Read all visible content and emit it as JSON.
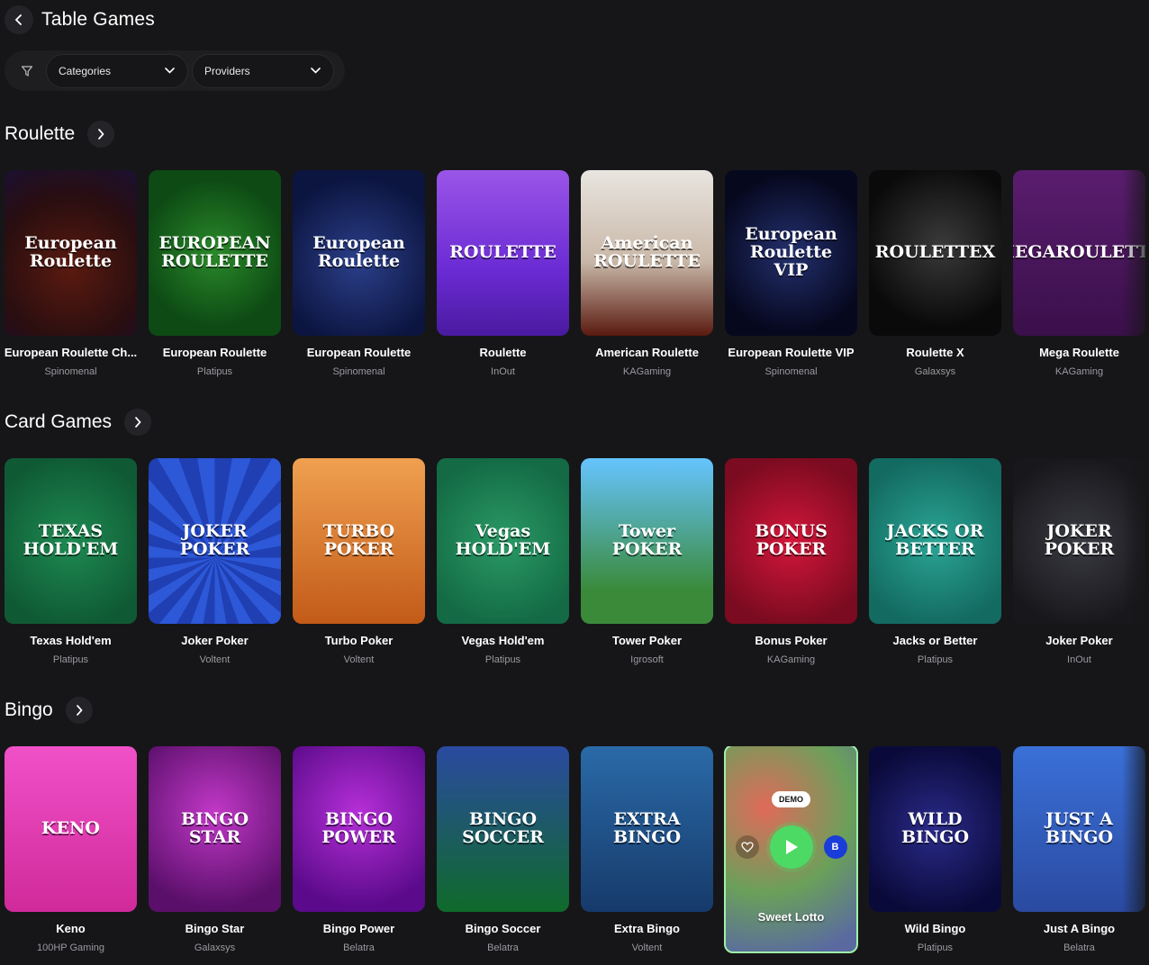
{
  "header": {
    "title": "Table Games"
  },
  "filters": {
    "categories_label": "Categories",
    "providers_label": "Providers"
  },
  "sections": [
    {
      "title": "Roulette",
      "games": [
        {
          "name": "European Roulette Ch...",
          "provider": "Spinomenal",
          "art": "European Roulette",
          "theme": "t-red"
        },
        {
          "name": "European Roulette",
          "provider": "Platipus",
          "art": "EUROPEAN ROULETTE",
          "theme": "t-green"
        },
        {
          "name": "European Roulette",
          "provider": "Spinomenal",
          "art": "European Roulette",
          "theme": "t-navy"
        },
        {
          "name": "Roulette",
          "provider": "InOut",
          "art": "ROULETTE",
          "theme": "t-purple"
        },
        {
          "name": "American Roulette",
          "provider": "KAGaming",
          "art": "American ROULETTE",
          "theme": "t-marble"
        },
        {
          "name": "European Roulette VIP",
          "provider": "Spinomenal",
          "art": "European Roulette VIP",
          "theme": "t-darkblue"
        },
        {
          "name": "Roulette X",
          "provider": "Galaxsys",
          "art": "ROULETTEX",
          "theme": "t-black"
        },
        {
          "name": "Mega Roulette",
          "provider": "KAGaming",
          "art": "MEGAROULETTE",
          "theme": "t-violet"
        }
      ]
    },
    {
      "title": "Card Games",
      "games": [
        {
          "name": "Texas Hold'em",
          "provider": "Platipus",
          "art": "TEXAS HOLD'EM",
          "theme": "t-feltgreen"
        },
        {
          "name": "Joker Poker",
          "provider": "Voltent",
          "art": "JOKER POKER",
          "theme": "t-rays"
        },
        {
          "name": "Turbo Poker",
          "provider": "Voltent",
          "art": "TURBO POKER",
          "theme": "t-orange"
        },
        {
          "name": "Vegas Hold'em",
          "provider": "Platipus",
          "art": "Vegas HOLD'EM",
          "theme": "t-vegas"
        },
        {
          "name": "Tower Poker",
          "provider": "Igrosoft",
          "art": "Tower POKER",
          "theme": "t-sky"
        },
        {
          "name": "Bonus Poker",
          "provider": "KAGaming",
          "art": "BONUS POKER",
          "theme": "t-bonus"
        },
        {
          "name": "Jacks or Better",
          "provider": "Platipus",
          "art": "JACKS OR BETTER",
          "theme": "t-teal"
        },
        {
          "name": "Joker Poker",
          "provider": "InOut",
          "art": "JOKER POKER",
          "theme": "t-graydark"
        }
      ]
    },
    {
      "title": "Bingo",
      "games": [
        {
          "name": "Keno",
          "provider": "100HP Gaming",
          "art": "KENO",
          "theme": "t-pink"
        },
        {
          "name": "Bingo Star",
          "provider": "Galaxsys",
          "art": "BINGO STAR",
          "theme": "t-magenta"
        },
        {
          "name": "Bingo Power",
          "provider": "Belatra",
          "art": "BINGO POWER",
          "theme": "t-bpower"
        },
        {
          "name": "Bingo Soccer",
          "provider": "Belatra",
          "art": "BINGO SOCCER",
          "theme": "t-stadium"
        },
        {
          "name": "Extra Bingo",
          "provider": "Voltent",
          "art": "EXTRA BINGO",
          "theme": "t-steel"
        },
        {
          "name": "Sweet Lotto",
          "provider": "",
          "art": "",
          "theme": "t-lotto",
          "hover": true,
          "demo_label": "DEMO"
        },
        {
          "name": "Wild Bingo",
          "provider": "Platipus",
          "art": "WILD BINGO",
          "theme": "t-wild"
        },
        {
          "name": "Just A Bingo",
          "provider": "Belatra",
          "art": "JUST A BINGO",
          "theme": "t-jab"
        }
      ]
    }
  ]
}
